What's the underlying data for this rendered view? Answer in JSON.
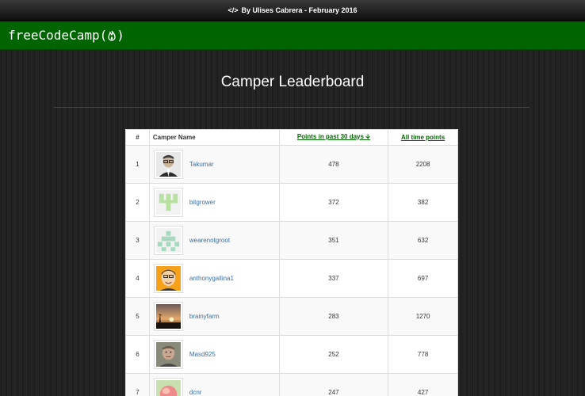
{
  "topbar": {
    "code_icon": "</>",
    "text": "By Ulises Cabrera - February 2016"
  },
  "header": {
    "logo_text": "freeCodeCamp(",
    "logo_close": ")",
    "logo_icon": "fire-icon"
  },
  "page": {
    "title": "Camper Leaderboard"
  },
  "table": {
    "col_rank": "#",
    "col_name": "Camper Name",
    "col_recent": "Points in past 30 days",
    "sort_arrow": "🡫",
    "col_alltime": "All time points",
    "rows": [
      {
        "rank": "1",
        "name": "Takumar",
        "recent": "478",
        "alltime": "2208",
        "avatar": "photo-man-glasses"
      },
      {
        "rank": "2",
        "name": "bitgrower",
        "recent": "372",
        "alltime": "382",
        "avatar": "identicon-green"
      },
      {
        "rank": "3",
        "name": "wearenotgroot",
        "recent": "351",
        "alltime": "632",
        "avatar": "identicon-teal"
      },
      {
        "rank": "4",
        "name": "anthonygallina1",
        "recent": "337",
        "alltime": "697",
        "avatar": "cartoon-face"
      },
      {
        "rank": "5",
        "name": "brainyfarm",
        "recent": "283",
        "alltime": "1270",
        "avatar": "sunset-photo"
      },
      {
        "rank": "6",
        "name": "Masd925",
        "recent": "252",
        "alltime": "778",
        "avatar": "photo-man"
      },
      {
        "rank": "7",
        "name": "dcnr",
        "recent": "247",
        "alltime": "427",
        "avatar": "peach-photo"
      }
    ]
  }
}
